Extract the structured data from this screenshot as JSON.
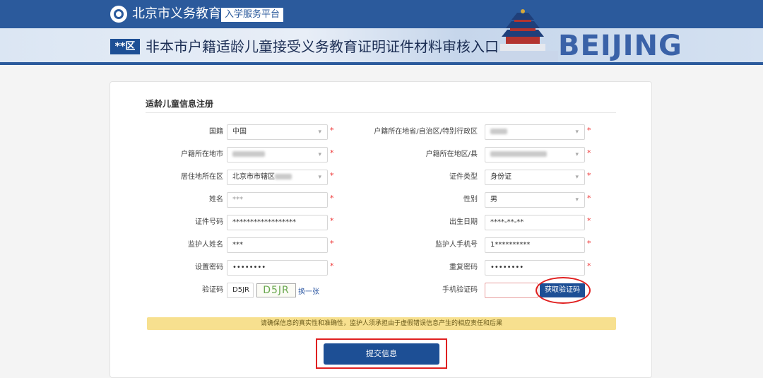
{
  "header": {
    "brand": "北京市义务教育",
    "tag": "入学服务平台",
    "region_badge": "**区",
    "title": "非本市户籍适龄儿童接受义务教育证明证件材料审核入口",
    "banner_word": "BEIJING"
  },
  "form": {
    "section_title": "适龄儿童信息注册",
    "left": [
      {
        "label": "国籍",
        "value": "中国",
        "type": "select"
      },
      {
        "label": "户籍所在地市",
        "value": "",
        "type": "select"
      },
      {
        "label": "居住地所在区",
        "value": "北京市市辖区",
        "type": "select"
      },
      {
        "label": "姓名",
        "value": "***",
        "type": "input"
      },
      {
        "label": "证件号码",
        "value": "******************",
        "type": "input"
      },
      {
        "label": "监护人姓名",
        "value": "***",
        "type": "input"
      },
      {
        "label": "设置密码",
        "value": "••••••••",
        "type": "password"
      },
      {
        "label": "验证码",
        "value": "D5JR",
        "type": "captcha"
      }
    ],
    "right": [
      {
        "label": "户籍所在地省/自治区/特别行政区",
        "value": "",
        "type": "select"
      },
      {
        "label": "户籍所在地区/县",
        "value": "",
        "type": "select"
      },
      {
        "label": "证件类型",
        "value": "身份证",
        "type": "select"
      },
      {
        "label": "性别",
        "value": "男",
        "type": "select"
      },
      {
        "label": "出生日期",
        "value": "****-**-**",
        "type": "input"
      },
      {
        "label": "监护人手机号",
        "value": "1**********",
        "type": "input"
      },
      {
        "label": "重复密码",
        "value": "••••••••",
        "type": "password"
      },
      {
        "label": "手机验证码",
        "value": "",
        "type": "input"
      }
    ],
    "captcha_image_text": "D5JR",
    "refresh_label": "换一张",
    "get_code_button": "获取验证码",
    "notice": "请确保信息的真实性和准确性，监护人须承担由于虚假错误信息产生的相应责任和后果",
    "submit_button": "提交信息"
  },
  "colors": {
    "primary": "#1d4f95",
    "highlight": "#e02020",
    "notice_bg": "#f7e08f"
  }
}
